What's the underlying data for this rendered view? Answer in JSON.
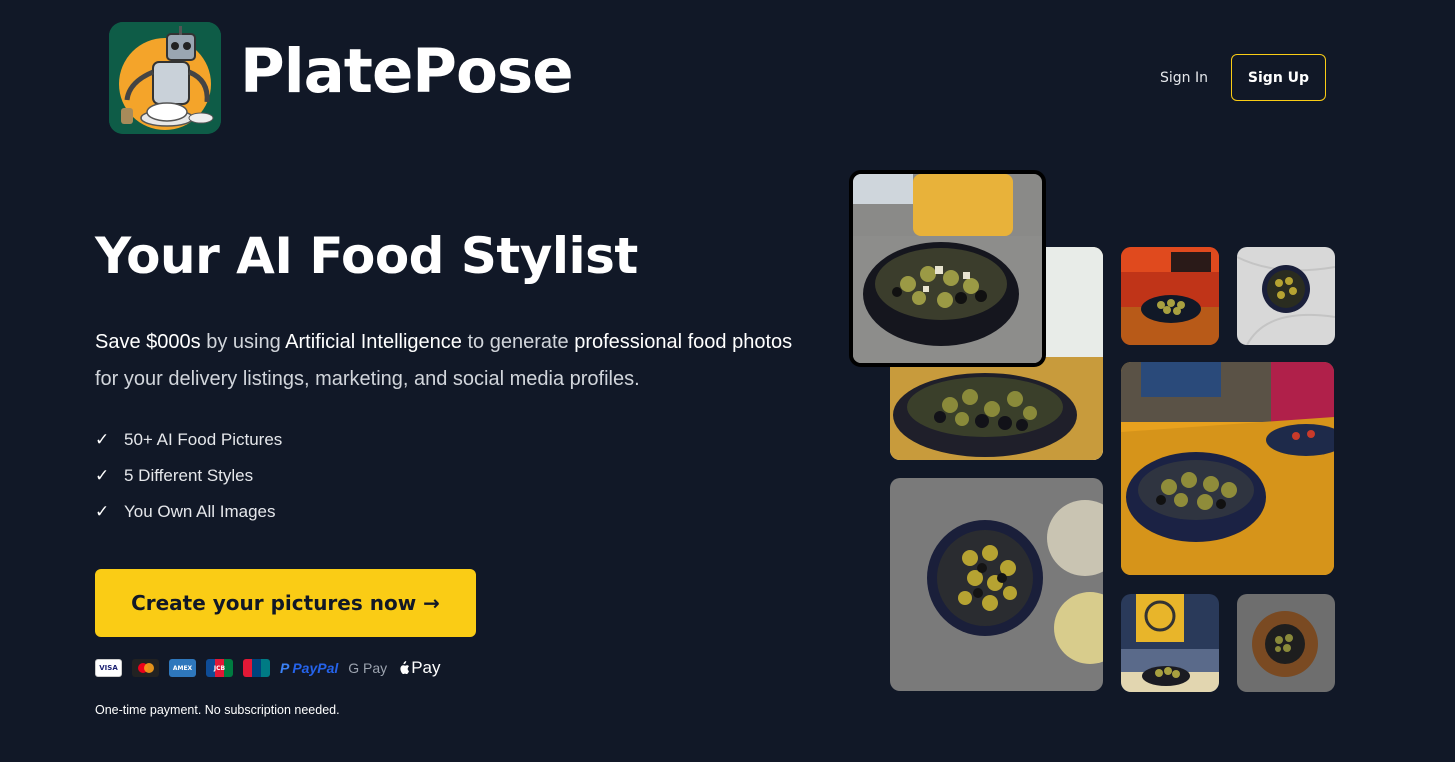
{
  "header": {
    "brand": "PlatePose",
    "sign_in": "Sign In",
    "sign_up": "Sign Up"
  },
  "hero": {
    "title": "Your AI Food Stylist",
    "desc": {
      "p1": "Save $000s",
      "p2": " by using ",
      "p3": "Artificial Intelligence",
      "p4": " to generate ",
      "p5": "professional food photos",
      "p6": " for your delivery listings, marketing, and social media profiles."
    },
    "features": [
      "50+ AI Food Pictures",
      "5 Different Styles",
      "You Own All Images"
    ],
    "check": "✓",
    "cta": "Create your pictures now →",
    "payments": {
      "paypal": "PayPal",
      "gpay": "G Pay",
      "applepay": "Pay",
      "visa": "VISA",
      "jcb": "JCB",
      "amex": "AMEX"
    },
    "note": "One-time payment. No subscription needed."
  }
}
